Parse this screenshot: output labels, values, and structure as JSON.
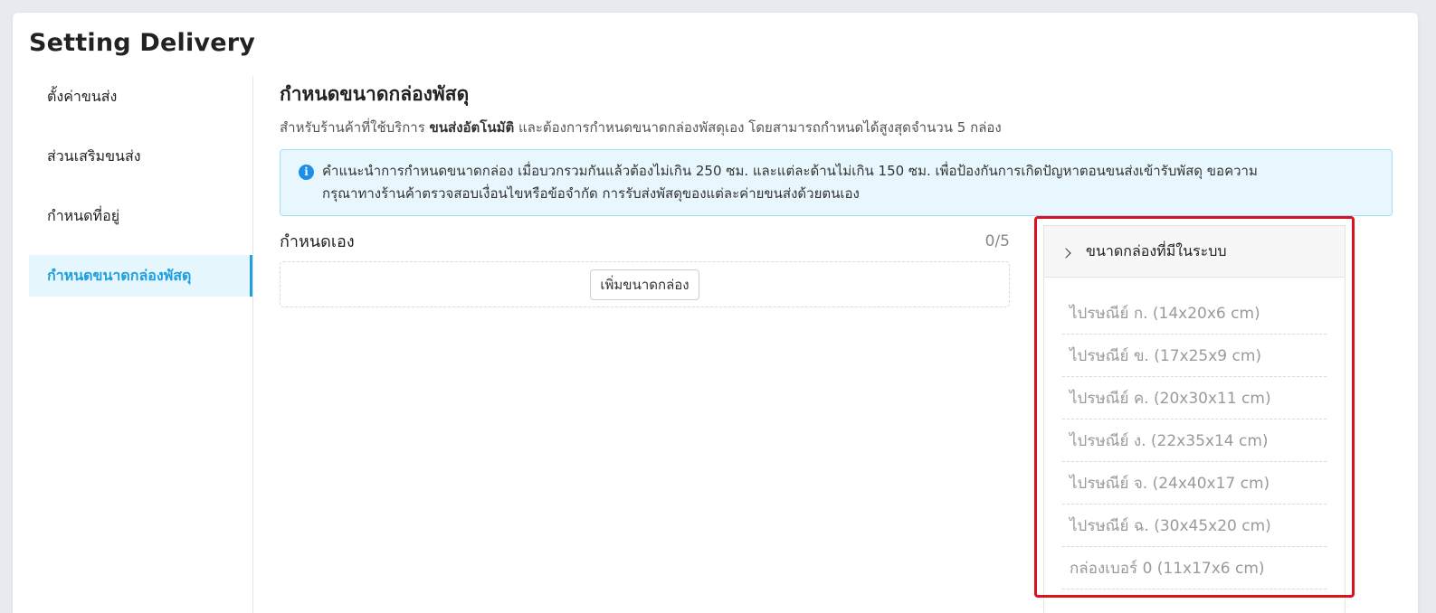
{
  "page": {
    "title": "Setting Delivery"
  },
  "sidebar": {
    "items": [
      {
        "label": "ตั้งค่าขนส่ง"
      },
      {
        "label": "ส่วนเสริมขนส่ง"
      },
      {
        "label": "กำหนดที่อยู่"
      },
      {
        "label": "กำหนดขนาดกล่องพัสดุ"
      }
    ],
    "active_index": 3
  },
  "main": {
    "title": "กำหนดขนาดกล่องพัสดุ",
    "desc_prefix": "สำหรับร้านค้าที่ใช้บริการ ",
    "desc_bold": "ขนส่งอัตโนมัติ",
    "desc_suffix": " และต้องการกำหนดขนาดกล่องพัสดุเอง โดยสามารถกำหนดได้สูงสุดจำนวน 5 กล่อง",
    "info_icon": "info-icon",
    "info_line1": "คำแนะนำการกำหนดขนาดกล่อง เมื่อบวกรวมกันแล้วต้องไม่เกิน 250 ซม. และแต่ละด้านไม่เกิน 150 ซม. เพื่อป้องกันการเกิดปัญหาตอนขนส่งเข้ารับพัสดุ ขอความ",
    "info_line2": "กรุณาทางร้านค้าตรวจสอบเงื่อนไขหรือข้อจำกัด การรับส่งพัสดุของแต่ละค่ายขนส่งด้วยตนเอง",
    "custom_label": "กำหนดเอง",
    "custom_count": "0/5",
    "add_button": "เพิ่มขนาดกล่อง"
  },
  "system_boxes": {
    "header": "ขนาดกล่องที่มีในระบบ",
    "items": [
      "ไปรษณีย์ ก. (14x20x6 cm)",
      "ไปรษณีย์ ข. (17x25x9 cm)",
      "ไปรษณีย์ ค. (20x30x11 cm)",
      "ไปรษณีย์ ง. (22x35x14 cm)",
      "ไปรษณีย์ จ. (24x40x17 cm)",
      "ไปรษณีย์ ฉ. (30x45x20 cm)",
      "กล่องเบอร์ 0 (11x17x6 cm)"
    ]
  },
  "colors": {
    "accent": "#1d9fe0",
    "info_bg": "#e8f7fd",
    "highlight": "#d9141e"
  }
}
